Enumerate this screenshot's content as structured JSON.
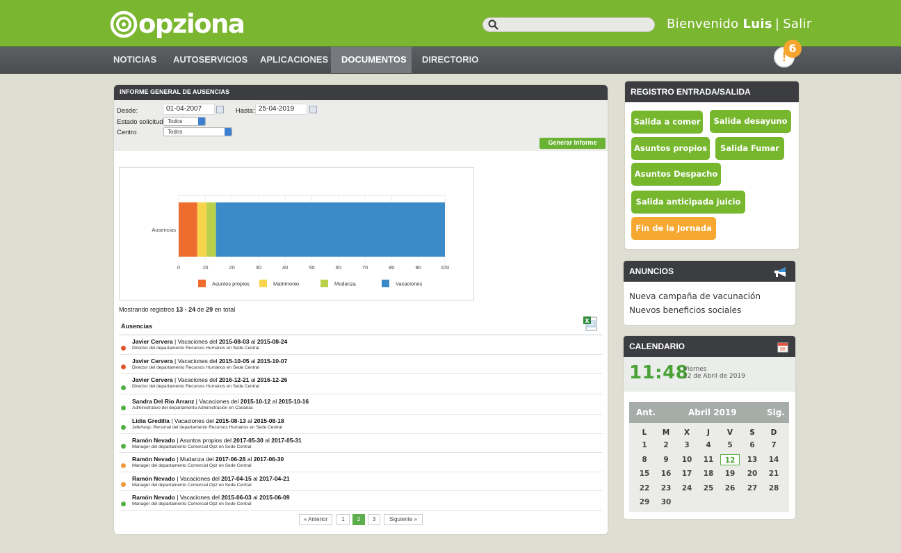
{
  "header": {
    "logo_text": "opziona",
    "search_placeholder": "",
    "welcome": "Bienvenido",
    "user": "Luis",
    "logout": "Salir"
  },
  "nav": [
    "NOTICIAS",
    "AUTOSERVICIOS",
    "APLICACIONES",
    "DOCUMENTOS",
    "DIRECTORIO"
  ],
  "nav_active": "DOCUMENTOS",
  "notifications": {
    "count": "6",
    "icon": "!"
  },
  "report": {
    "title": "INFORME GENERAL DE AUSENCIAS",
    "desde_label": "Desde:",
    "desde_value": "01-04-2007",
    "hasta_label": "Hasta:",
    "hasta_value": "25-04-2019",
    "estado_label": "Estado solicitud",
    "estado_value": "Todos",
    "centro_label": "Centro",
    "centro_value": "Todos",
    "generate_button": "Generar Informe"
  },
  "chart_data": {
    "type": "bar",
    "orientation": "horizontal",
    "stacked": true,
    "categories": [
      "Ausencias"
    ],
    "series": [
      {
        "name": "Asuntos propios",
        "values": [
          7
        ],
        "color": "#ee6d2e"
      },
      {
        "name": "Matrimonio",
        "values": [
          3.5
        ],
        "color": "#f8d44c"
      },
      {
        "name": "Mudanza",
        "values": [
          3.5
        ],
        "color": "#b9d04a"
      },
      {
        "name": "Vacaciones",
        "values": [
          86
        ],
        "color": "#3b8bc8"
      }
    ],
    "xticks": [
      "0",
      "10",
      "20",
      "30",
      "40",
      "50",
      "60",
      "70",
      "80",
      "90",
      "100"
    ],
    "xlim": [
      0,
      100
    ],
    "legend": "bottom",
    "grid": true
  },
  "showing": {
    "prefix": "Mostrando registros",
    "range": "13 - 24",
    "of": "de",
    "total": "29",
    "suffix": "en total"
  },
  "list": {
    "header": "Ausencias",
    "rows": [
      {
        "name": "Javier Cervera",
        "type": "Vacaciones del",
        "from": "2015-08-03",
        "al": "al",
        "to": "2015-08-24",
        "role": "Director del departamento Recursos Humanos en Sede Central",
        "status": "#e0562c"
      },
      {
        "name": "Javier Cervera",
        "type": "Vacaciones del",
        "from": "2015-10-05",
        "al": "al",
        "to": "2015-10-07",
        "role": "Director del departamento Recursos Humanos en Sede Central",
        "status": "#e0562c"
      },
      {
        "name": "Javier Cervera",
        "type": "Vacaciones del",
        "from": "2016-12-21",
        "al": "al",
        "to": "2016-12-26",
        "role": "Director del departamento Recursos Humanos en Sede Central",
        "status": "#52ae45"
      },
      {
        "name": "Sandra Del Rio Arranz",
        "type": "Vacaciones del",
        "from": "2015-10-12",
        "al": "al",
        "to": "2015-10-16",
        "role": "Administrativo del departamento Administración en Canarias",
        "status": "#52ae45"
      },
      {
        "name": "Lidia Gredilla",
        "type": "Vacaciones del",
        "from": "2015-08-13",
        "al": "al",
        "to": "2015-08-18",
        "role": "Jefe/resp. Personal del departamento Recursos Humanos en Sede Central",
        "status": "#52ae45"
      },
      {
        "name": "Ramón Nevado",
        "type": "Asuntos propios del",
        "from": "2017-05-30",
        "al": "al",
        "to": "2017-05-31",
        "role": "Manager del departamento Comercial Opz en Sede Central",
        "status": "#52ae45"
      },
      {
        "name": "Ramón Nevado",
        "type": "Mudanza del",
        "from": "2017-06-28",
        "al": "al",
        "to": "2017-06-30",
        "role": "Manager del departamento Comercial Opz en Sede Central",
        "status": "#f19a3a"
      },
      {
        "name": "Ramón Nevado",
        "type": "Vacaciones del",
        "from": "2017-04-15",
        "al": "al",
        "to": "2017-04-21",
        "role": "Manager del departamento Comercial Opz en Sede Central",
        "status": "#f19a3a"
      },
      {
        "name": "Ramón Nevado",
        "type": "Vacaciones del",
        "from": "2015-06-03",
        "al": "al",
        "to": "2015-06-09",
        "role": "Manager del departamento Comercial Opz en Sede Central",
        "status": "#52ae45"
      }
    ]
  },
  "pagination": {
    "prev": "« Anterior",
    "pages": [
      "1",
      "2",
      "3"
    ],
    "active": "2",
    "next": "Siguiente »"
  },
  "registro": {
    "title": "REGISTRO ENTRADA/SALIDA",
    "buttons": [
      "Salida a comer",
      "Salida desayuno",
      "Asuntos propios",
      "Salida Fumar",
      "Asuntos Despacho",
      "Salida anticipada juicio",
      "Fin de la Jornada"
    ]
  },
  "anuncios": {
    "title": "ANUNCIOS",
    "icon": "megaphone-icon",
    "items": [
      "Nueva campaña de vacunación",
      "Nuevos beneficios sociales"
    ]
  },
  "calendario": {
    "title": "CALENDARIO",
    "icon": "calendar-icon",
    "time": "11:48",
    "day": "Viernes",
    "date": "12 de Abril de 2019",
    "prev": "Ant.",
    "month": "Abril 2019",
    "next": "Sig.",
    "weekdays": [
      "L",
      "M",
      "X",
      "J",
      "V",
      "S",
      "D"
    ],
    "days": [
      "1",
      "2",
      "3",
      "4",
      "5",
      "6",
      "7",
      "8",
      "9",
      "10",
      "11",
      "12",
      "13",
      "14",
      "15",
      "16",
      "17",
      "18",
      "19",
      "20",
      "21",
      "22",
      "23",
      "24",
      "25",
      "26",
      "27",
      "28",
      "29",
      "30"
    ],
    "today": "12"
  },
  "colors": {
    "brand_green": "#7ab630",
    "nav_dark": "#4b4e51",
    "accent_orange": "#f6a830",
    "chart_blue": "#3b8bc8"
  }
}
